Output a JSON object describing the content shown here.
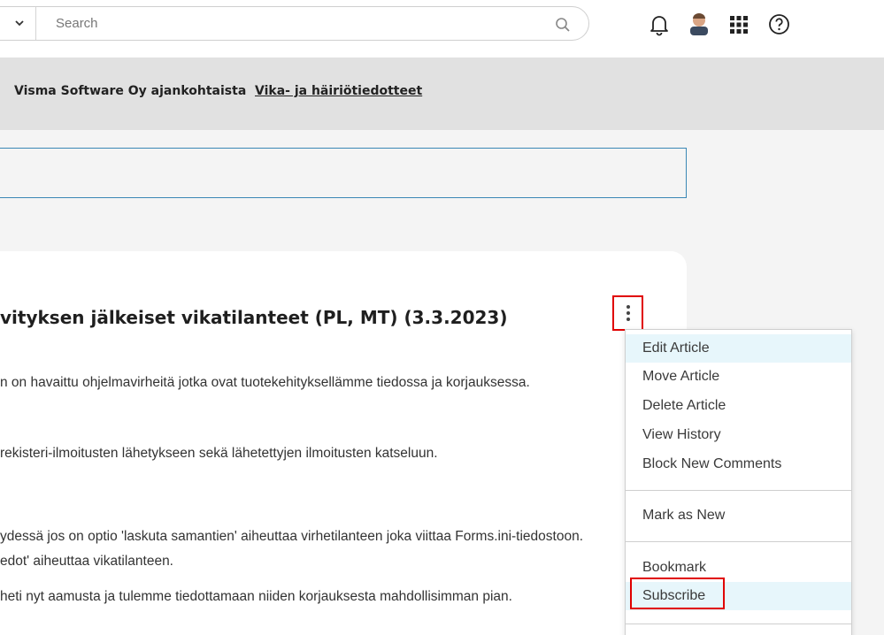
{
  "header": {
    "search": {
      "placeholder": "Search",
      "value": ""
    },
    "icons": [
      "chevron-down-icon",
      "search-icon",
      "bell-icon",
      "avatar",
      "apps-grid-icon",
      "help-icon"
    ]
  },
  "nav": {
    "link_1": "Visma Software Oy ajankohtaista",
    "link_2": "Vika- ja häiriötiedotteet"
  },
  "article": {
    "title": "vityksen jälkeiset vikatilanteet (PL, MT) (3.3.2023)",
    "paragraphs": [
      "n on havaittu ohjelmavirheitä jotka ovat tuotekehityksellämme tiedossa ja korjauksessa.",
      "rekisteri-ilmoitusten lähetykseen sekä lähetettyjen ilmoitusten katseluun.",
      "ydessä jos on optio 'laskuta samantien' aiheuttaa virhetilanteen joka viittaa Forms.ini-tiedostoon.",
      "edot' aiheuttaa vikatilanteen.",
      " heti nyt aamusta ja tulemme tiedottamaan niiden korjauksesta mahdollisimman pian."
    ]
  },
  "menu": {
    "edit": "Edit Article",
    "move": "Move Article",
    "delete": "Delete Article",
    "history": "View History",
    "block": "Block New Comments",
    "mark_new": "Mark as New",
    "bookmark": "Bookmark",
    "subscribe": "Subscribe"
  },
  "colors": {
    "highlight_red": "#e00000",
    "menu_hover": "#e7f6fb",
    "nav_band": "#e1e1e1",
    "info_border": "#3a87b5"
  }
}
